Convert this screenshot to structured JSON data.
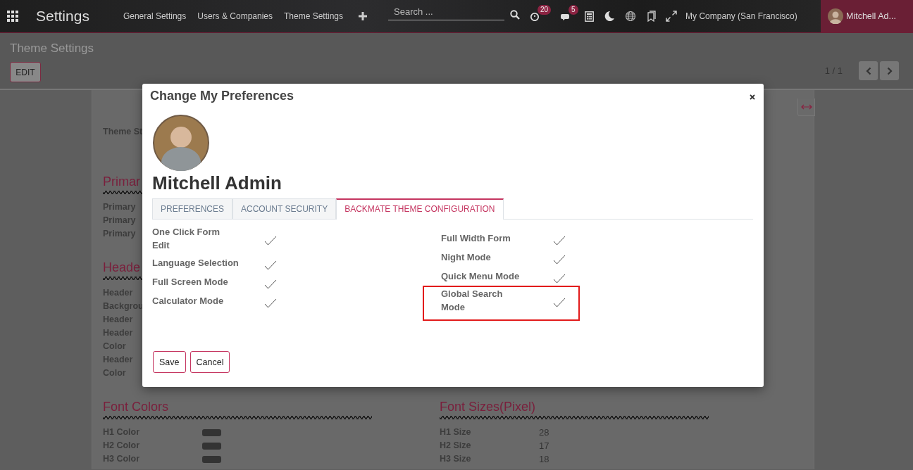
{
  "navbar": {
    "app_title": "Settings",
    "menu": [
      "General Settings",
      "Users & Companies",
      "Theme Settings"
    ],
    "search": {
      "placeholder": "Search ..."
    },
    "activity_count": "20",
    "message_count": "5",
    "company": "My Company (San Francisco)",
    "user_name": "Mitchell Ad..."
  },
  "control_panel": {
    "title": "Theme Settings",
    "edit_button": "EDIT",
    "pager": "1 / 1"
  },
  "sheet": {
    "top_field": "Theme St",
    "upper_sections": [
      {
        "heading": "Primar",
        "rows": [
          "Primary",
          "Primary",
          "Primary"
        ]
      },
      {
        "heading": "Heade",
        "rows": [
          "Header",
          "Backgrou",
          "Header",
          "Header",
          "Color",
          "Header",
          "Color"
        ]
      }
    ],
    "lower_sections": [
      {
        "heading": "Font Colors",
        "rows": [
          {
            "label": "H1 Color",
            "kind": "swatch"
          },
          {
            "label": "H2 Color",
            "kind": "swatch"
          },
          {
            "label": "H3 Color",
            "kind": "swatch"
          }
        ]
      },
      {
        "heading": "Font Sizes(Pixel)",
        "rows": [
          {
            "label": "H1 Size",
            "kind": "value",
            "value": "28"
          },
          {
            "label": "H2 Size",
            "kind": "value",
            "value": "17"
          },
          {
            "label": "H3 Size",
            "kind": "value",
            "value": "18"
          }
        ]
      }
    ]
  },
  "dialog": {
    "title": "Change My Preferences",
    "user_name": "Mitchell Admin",
    "tabs": [
      {
        "label": "PREFERENCES",
        "selected": false
      },
      {
        "label": "ACCOUNT SECURITY",
        "selected": false
      },
      {
        "label": "BACKMATE THEME CONFIGURATION",
        "selected": true
      }
    ],
    "settings_left": [
      {
        "label": "One Click Form Edit",
        "checked": true,
        "highlighted": false
      },
      {
        "label": "Language Selection",
        "checked": true,
        "highlighted": false
      },
      {
        "label": "Full Screen Mode",
        "checked": true,
        "highlighted": false
      },
      {
        "label": "Calculator Mode",
        "checked": true,
        "highlighted": false
      }
    ],
    "settings_right": [
      {
        "label": "Full Width Form",
        "checked": true,
        "highlighted": false
      },
      {
        "label": "Night Mode",
        "checked": true,
        "highlighted": false
      },
      {
        "label": "Quick Menu Mode",
        "checked": true,
        "highlighted": false
      },
      {
        "label": "Global Search Mode",
        "checked": true,
        "highlighted": true
      }
    ],
    "buttons": [
      "Save",
      "Cancel"
    ]
  }
}
